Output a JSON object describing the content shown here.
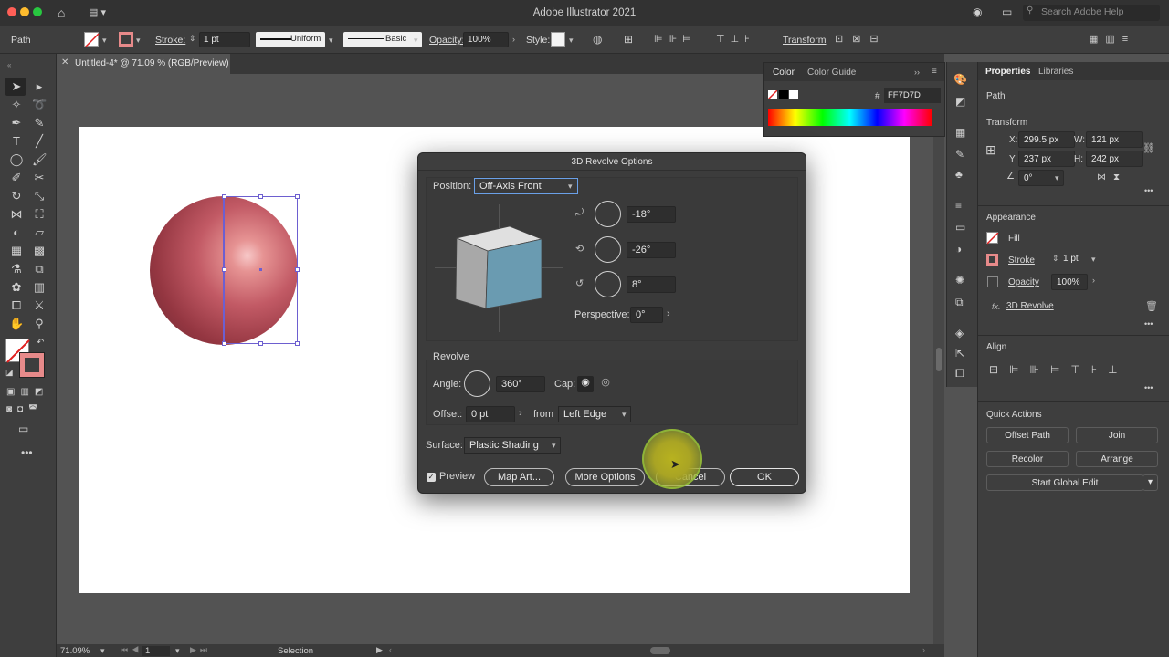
{
  "app": {
    "title": "Adobe Illustrator 2021",
    "search_placeholder": "Search Adobe Help"
  },
  "controlbar": {
    "selection_type": "Path",
    "stroke_label": "Stroke:",
    "stroke_value": "1 pt",
    "profile_uniform": "Uniform",
    "brush_basic": "Basic",
    "opacity_label": "Opacity:",
    "opacity_value": "100%",
    "style_label": "Style:",
    "transform_link": "Transform"
  },
  "document": {
    "tab_title": "Untitled-4* @ 71.09 % (RGB/Preview)"
  },
  "statusbar": {
    "zoom": "71.09%",
    "artboard_num": "1",
    "tool": "Selection"
  },
  "color_panel": {
    "tab_color": "Color",
    "tab_guide": "Color Guide",
    "hex_prefix": "#",
    "hex_value": "FF7D7D"
  },
  "properties": {
    "tab_properties": "Properties",
    "tab_libraries": "Libraries",
    "type": "Path",
    "transform_heading": "Transform",
    "x_label": "X:",
    "x_value": "299.5 px",
    "y_label": "Y:",
    "y_value": "237 px",
    "w_label": "W:",
    "w_value": "121 px",
    "h_label": "H:",
    "h_value": "242 px",
    "angle_value": "0°",
    "appearance_heading": "Appearance",
    "fill_label": "Fill",
    "stroke_label": "Stroke",
    "stroke_value": "1 pt",
    "opacity_label": "Opacity",
    "opacity_value": "100%",
    "effect_name": "3D Revolve",
    "fx_label": "fx.",
    "align_heading": "Align",
    "quick_actions_heading": "Quick Actions",
    "btn_offset_path": "Offset Path",
    "btn_join": "Join",
    "btn_recolor": "Recolor",
    "btn_arrange": "Arrange",
    "btn_global_edit": "Start Global Edit"
  },
  "dialog": {
    "title": "3D Revolve Options",
    "position_label": "Position:",
    "position_value": "Off-Axis Front",
    "rot_x": "-18°",
    "rot_y": "-26°",
    "rot_z": "8°",
    "perspective_label": "Perspective:",
    "perspective_value": "0°",
    "revolve_heading": "Revolve",
    "angle_label": "Angle:",
    "angle_value": "360°",
    "cap_label": "Cap:",
    "offset_label": "Offset:",
    "offset_value": "0 pt",
    "from_label": "from",
    "from_value": "Left Edge",
    "surface_label": "Surface:",
    "surface_value": "Plastic Shading",
    "preview_label": "Preview",
    "btn_map_art": "Map Art...",
    "btn_more_options": "More Options",
    "btn_cancel": "Cancel",
    "btn_ok": "OK"
  },
  "colors": {
    "accent": "#ff7d7d",
    "selection": "#6d5fd0",
    "cube_face": "#6a9bb1"
  }
}
